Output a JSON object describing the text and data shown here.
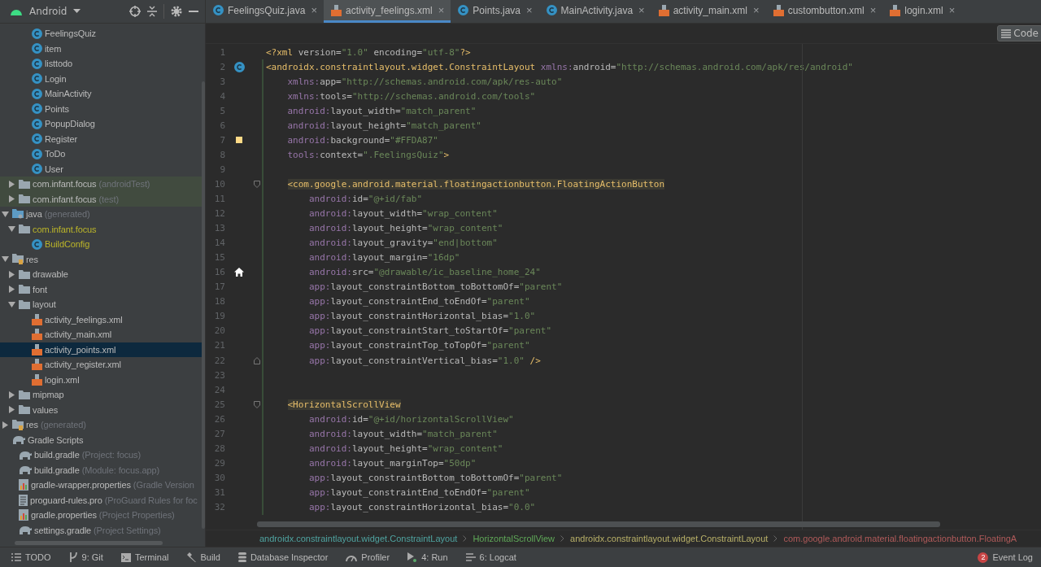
{
  "project_view": {
    "title": "Android"
  },
  "tree": [
    {
      "children": [
        {
          "children": [
            {
              "label": "FeelingsQuiz",
              "kind": "class",
              "selected": false
            },
            {
              "label": "item",
              "kind": "class",
              "selected": false
            },
            {
              "label": "listtodo",
              "kind": "class",
              "selected": false
            },
            {
              "label": "Login",
              "kind": "class",
              "selected": false
            },
            {
              "label": "MainActivity",
              "kind": "class",
              "selected": false
            },
            {
              "label": "Points",
              "kind": "class",
              "selected": false
            },
            {
              "label": "PopupDialog",
              "kind": "class",
              "selected": false
            },
            {
              "label": "Register",
              "kind": "class",
              "selected": false
            },
            {
              "label": "ToDo",
              "kind": "class",
              "selected": false
            },
            {
              "label": "User",
              "kind": "class",
              "selected": false
            }
          ]
        },
        {
          "label": "com.infant.focus",
          "note": "(androidTest)",
          "kind": "folder",
          "test": true,
          "expanded": false,
          "selected": false
        },
        {
          "label": "com.infant.focus",
          "note": "(test)",
          "kind": "folder",
          "test": true,
          "expanded": false,
          "selected": false
        }
      ]
    },
    {
      "label": "java",
      "note": "(generated)",
      "kind": "src-folder",
      "expanded": true,
      "selected": false,
      "children": [
        {
          "label": "com.infant.focus",
          "kind": "folder",
          "generated": true,
          "expanded": true,
          "selected": false,
          "children": [
            {
              "label": "BuildConfig",
              "kind": "class",
              "generated": true,
              "selected": false
            }
          ]
        }
      ]
    },
    {
      "label": "res",
      "kind": "res-folder",
      "expanded": true,
      "selected": false,
      "children": [
        {
          "label": "drawable",
          "kind": "folder",
          "expanded": false,
          "selected": false
        },
        {
          "label": "font",
          "kind": "folder",
          "expanded": false,
          "selected": false
        },
        {
          "label": "layout",
          "kind": "folder",
          "expanded": true,
          "selected": false,
          "children": [
            {
              "label": "activity_feelings.xml",
              "kind": "xml",
              "selected": false
            },
            {
              "label": "activity_main.xml",
              "kind": "xml",
              "selected": false
            },
            {
              "label": "activity_points.xml",
              "kind": "xml",
              "selected": true
            },
            {
              "label": "activity_register.xml",
              "kind": "xml",
              "selected": false
            },
            {
              "label": "login.xml",
              "kind": "xml",
              "selected": false
            }
          ]
        },
        {
          "label": "mipmap",
          "kind": "folder",
          "expanded": false,
          "selected": false
        },
        {
          "label": "values",
          "kind": "folder",
          "expanded": false,
          "selected": false
        }
      ]
    },
    {
      "label": "res",
      "note": "(generated)",
      "kind": "res-folder",
      "expanded": false,
      "selected": false
    },
    {
      "label": "Gradle Scripts",
      "kind": "gradle",
      "selected": false,
      "children": [
        {
          "label": "build.gradle",
          "note": "(Project: focus)",
          "kind": "gradle",
          "selected": false
        },
        {
          "label": "build.gradle",
          "note": "(Module: focus.app)",
          "kind": "gradle",
          "selected": false
        },
        {
          "label": "gradle-wrapper.properties",
          "note": "(Gradle Version",
          "kind": "properties",
          "selected": false
        },
        {
          "label": "proguard-rules.pro",
          "note": "(ProGuard Rules for foc",
          "kind": "text",
          "selected": false
        },
        {
          "label": "gradle.properties",
          "note": "(Project Properties)",
          "kind": "properties",
          "selected": false
        },
        {
          "label": "settings.gradle",
          "note": "(Project Settings)",
          "kind": "gradle",
          "selected": false
        }
      ]
    }
  ],
  "tabs": [
    {
      "label": "FeelingsQuiz.java",
      "kind": "class",
      "close": "×",
      "selected": false
    },
    {
      "label": "activity_feelings.xml",
      "kind": "xml",
      "close": "×",
      "selected": true
    },
    {
      "label": "Points.java",
      "kind": "class",
      "close": "×",
      "selected": false
    },
    {
      "label": "MainActivity.java",
      "kind": "class",
      "close": "×",
      "selected": false
    },
    {
      "label": "activity_main.xml",
      "kind": "xml",
      "close": "×",
      "selected": false
    },
    {
      "label": "custombutton.xml",
      "kind": "xml",
      "close": "×",
      "selected": false
    },
    {
      "label": "login.xml",
      "kind": "xml",
      "close": "×",
      "selected": false
    }
  ],
  "view_mode_button": "Code",
  "code_lines": [
    {
      "n": "1",
      "text": "<?xml version=\"1.0\" encoding=\"utf-8\"?>",
      "added": false
    },
    {
      "n": "2",
      "text": "<androidx.constraintlayout.widget.ConstraintLayout xmlns:android=\"http://schemas.android.com/apk/res/android\"",
      "gutter_icon": {
        "kind": "class"
      },
      "added": true
    },
    {
      "n": "3",
      "text": "    xmlns:app=\"http://schemas.android.com/apk/res-auto\"",
      "added": true
    },
    {
      "n": "4",
      "text": "    xmlns:tools=\"http://schemas.android.com/tools\"",
      "added": true
    },
    {
      "n": "5",
      "text": "    android:layout_width=\"match_parent\"",
      "added": true
    },
    {
      "n": "6",
      "text": "    android:layout_height=\"match_parent\"",
      "added": true
    },
    {
      "n": "7",
      "text": "    android:background=\"#FFDA87\"",
      "gutter_icon": {
        "kind": "swatch",
        "color": "#ffda87"
      },
      "added": true
    },
    {
      "n": "8",
      "text": "    tools:context=\".FeelingsQuiz\">",
      "added": true
    },
    {
      "n": "9",
      "added": true
    },
    {
      "n": "10",
      "text": "    <com.google.android.material.floatingactionbutton.FloatingActionButton",
      "matched": true,
      "fold_marker": {
        "kind": "start"
      },
      "added": true
    },
    {
      "n": "11",
      "text": "        android:id=\"@+id/fab\"",
      "added": true
    },
    {
      "n": "12",
      "text": "        android:layout_width=\"wrap_content\"",
      "added": true
    },
    {
      "n": "13",
      "text": "        android:layout_height=\"wrap_content\"",
      "added": true
    },
    {
      "n": "14",
      "text": "        android:layout_gravity=\"end|bottom\"",
      "added": true
    },
    {
      "n": "15",
      "text": "        android:layout_margin=\"16dp\"",
      "added": true
    },
    {
      "n": "16",
      "text": "        android:src=\"@drawable/ic_baseline_home_24\"",
      "gutter_icon": {
        "kind": "home"
      },
      "added": true
    },
    {
      "n": "17",
      "text": "        app:layout_constraintBottom_toBottomOf=\"parent\"",
      "added": true
    },
    {
      "n": "18",
      "text": "        app:layout_constraintEnd_toEndOf=\"parent\"",
      "added": true
    },
    {
      "n": "19",
      "text": "        app:layout_constraintHorizontal_bias=\"1.0\"",
      "added": true
    },
    {
      "n": "20",
      "text": "        app:layout_constraintStart_toStartOf=\"parent\"",
      "added": true
    },
    {
      "n": "21",
      "text": "        app:layout_constraintTop_toTopOf=\"parent\"",
      "added": true
    },
    {
      "n": "22",
      "text": "        app:layout_constraintVertical_bias=\"1.0\" />",
      "fold_marker": {
        "kind": "end"
      },
      "added": true
    },
    {
      "n": "23",
      "added": true
    },
    {
      "n": "24",
      "added": true
    },
    {
      "n": "25",
      "text": "    <HorizontalScrollView",
      "matched": true,
      "fold_marker": {
        "kind": "start"
      },
      "added": true
    },
    {
      "n": "26",
      "text": "        android:id=\"@+id/horizontalScrollView\"",
      "added": true
    },
    {
      "n": "27",
      "text": "        android:layout_width=\"match_parent\"",
      "added": true
    },
    {
      "n": "28",
      "text": "        android:layout_height=\"wrap_content\"",
      "added": true
    },
    {
      "n": "29",
      "text": "        android:layout_marginTop=\"50dp\"",
      "added": true
    },
    {
      "n": "30",
      "text": "        app:layout_constraintBottom_toBottomOf=\"parent\"",
      "added": true
    },
    {
      "n": "31",
      "text": "        app:layout_constraintEnd_toEndOf=\"parent\"",
      "added": true
    },
    {
      "n": "32",
      "text": "        app:layout_constraintHorizontal_bias=\"0.0\"",
      "added": true
    }
  ],
  "breadcrumbs": [
    {
      "label": "androidx.constraintlayout.widget.ConstraintLayout",
      "color": "#4fa3a0"
    },
    {
      "label": "HorizontalScrollView",
      "color": "#5fa858"
    },
    {
      "label": "androidx.constraintlayout.widget.ConstraintLayout",
      "color": "#b8b068"
    },
    {
      "label": "com.google.android.material.floatingactionbutton.FloatingA",
      "color": "#b05a5a"
    }
  ],
  "tool_windows": [
    {
      "label": "TODO",
      "kind": "list"
    },
    {
      "label": "9: Git",
      "kind": "git"
    },
    {
      "label": "Terminal",
      "kind": "terminal"
    },
    {
      "label": "Build",
      "kind": "build"
    },
    {
      "label": "Database Inspector",
      "kind": "database"
    },
    {
      "label": "Profiler",
      "kind": "gauge"
    },
    {
      "label": "4: Run",
      "kind": "run"
    },
    {
      "label": "6: Logcat",
      "kind": "logcat"
    }
  ],
  "event_log": {
    "label": "Event Log",
    "count": "2"
  }
}
